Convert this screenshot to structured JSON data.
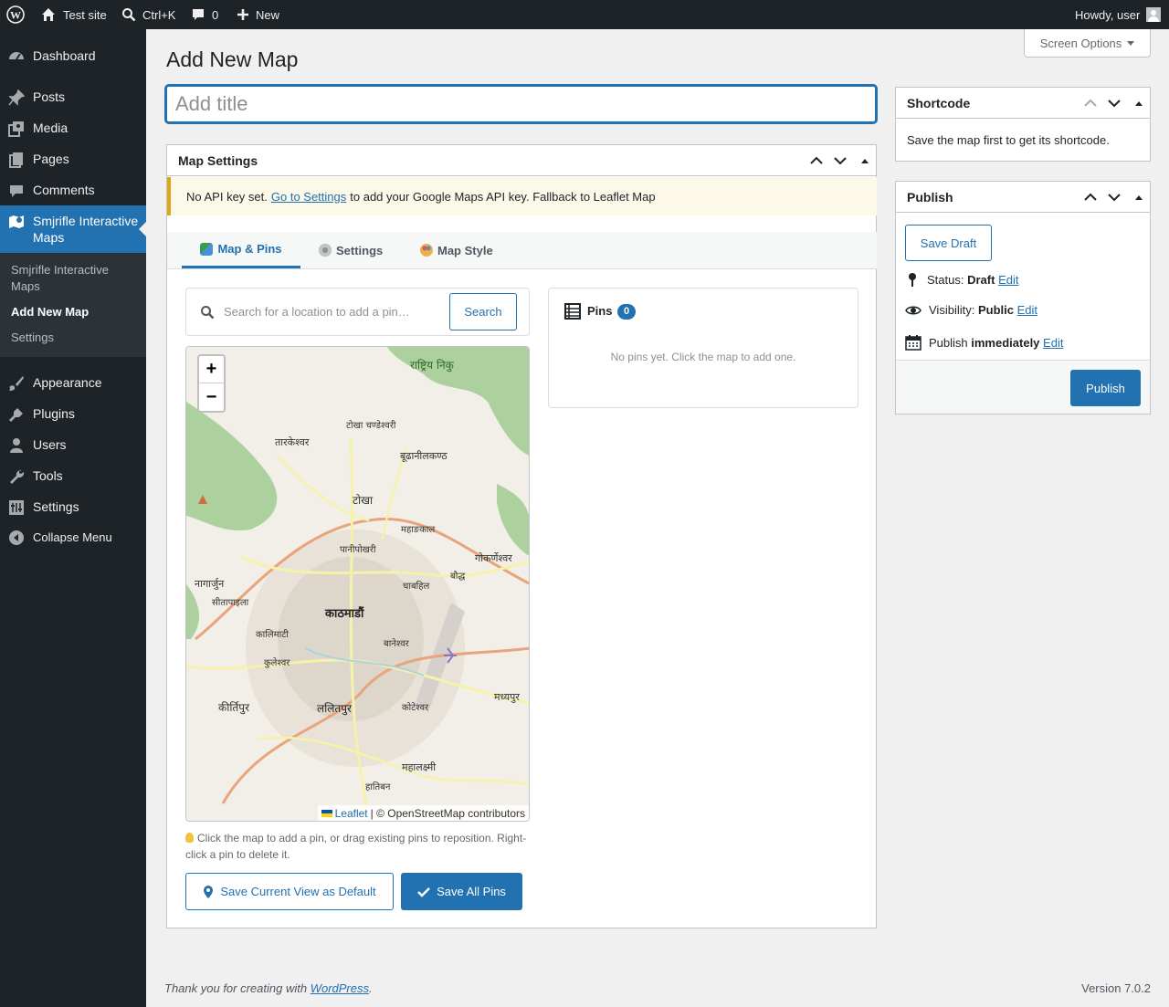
{
  "adminbar": {
    "site_name": "Test site",
    "search_shortcut": "Ctrl+K",
    "comments_count": "0",
    "new_label": "New",
    "greeting": "Howdy, user"
  },
  "sidebar": {
    "items": [
      {
        "label": "Dashboard",
        "icon": "dashboard-icon"
      },
      {
        "label": "Posts",
        "icon": "pin-icon"
      },
      {
        "label": "Media",
        "icon": "media-icon"
      },
      {
        "label": "Pages",
        "icon": "pages-icon"
      },
      {
        "label": "Comments",
        "icon": "comments-icon"
      },
      {
        "label": "Smjrifle Interactive Maps",
        "icon": "map-icon"
      },
      {
        "label": "Appearance",
        "icon": "brush-icon"
      },
      {
        "label": "Plugins",
        "icon": "plugin-icon"
      },
      {
        "label": "Users",
        "icon": "user-icon"
      },
      {
        "label": "Tools",
        "icon": "wrench-icon"
      },
      {
        "label": "Settings",
        "icon": "settings-icon"
      },
      {
        "label": "Collapse Menu",
        "icon": "collapse-icon"
      }
    ],
    "submenu": [
      "Smjrifle Interactive Maps",
      "Add New Map",
      "Settings"
    ]
  },
  "screen_options": "Screen Options",
  "page_title": "Add New Map",
  "title_placeholder": "Add title",
  "map_settings": {
    "heading": "Map Settings",
    "notice_before": "No API key set.",
    "notice_link": "Go to Settings",
    "notice_after": "to add your Google Maps API key. Fallback to Leaflet Map",
    "tabs": [
      "Map & Pins",
      "Settings",
      "Map Style"
    ],
    "search_placeholder": "Search for a location to add a pin…",
    "search_button": "Search",
    "pins_title": "Pins",
    "pins_count": "0",
    "pins_empty": "No pins yet. Click the map to add one.",
    "map_labels": [
      "राष्ट्रिय निकु",
      "टोखा चण्डेश्वरी",
      "तारकेश्वर",
      "बूढानीलकण्ठ",
      "टोखा",
      "महाङकाल",
      "पानीपोखरी",
      "गोकर्णेश्वर",
      "नागार्जुन",
      "सीतापाइला",
      "चाबहिल",
      "बौद्ध",
      "काठमाडौं",
      "कालिमाटी",
      "बानेश्वर",
      "कुलेश्वर",
      "कीर्तिपुर",
      "ललितपुर",
      "कोटेश्वर",
      "मध्यपुर",
      "महालक्ष्मी",
      "हातिबन"
    ],
    "attribution_link": "Leaflet",
    "attribution_text": "| © OpenStreetMap contributors",
    "hint": "Click the map to add a pin, or drag existing pins to reposition. Right-click a pin to delete it.",
    "save_view_button": "Save Current View as Default",
    "save_pins_button": "Save All Pins"
  },
  "shortcode": {
    "heading": "Shortcode",
    "text": "Save the map first to get its shortcode."
  },
  "publish": {
    "heading": "Publish",
    "save_draft": "Save Draft",
    "status_label": "Status:",
    "status_value": "Draft",
    "visibility_label": "Visibility:",
    "visibility_value": "Public",
    "publish_label": "Publish",
    "publish_value": "immediately",
    "edit": "Edit",
    "publish_button": "Publish"
  },
  "footer": {
    "thanks": "Thank you for creating with",
    "link": "WordPress",
    "version": "Version 7.0.2"
  },
  "colors": {
    "accent": "#2271b1",
    "adminbar": "#1d2327",
    "notice": "#dba617"
  }
}
